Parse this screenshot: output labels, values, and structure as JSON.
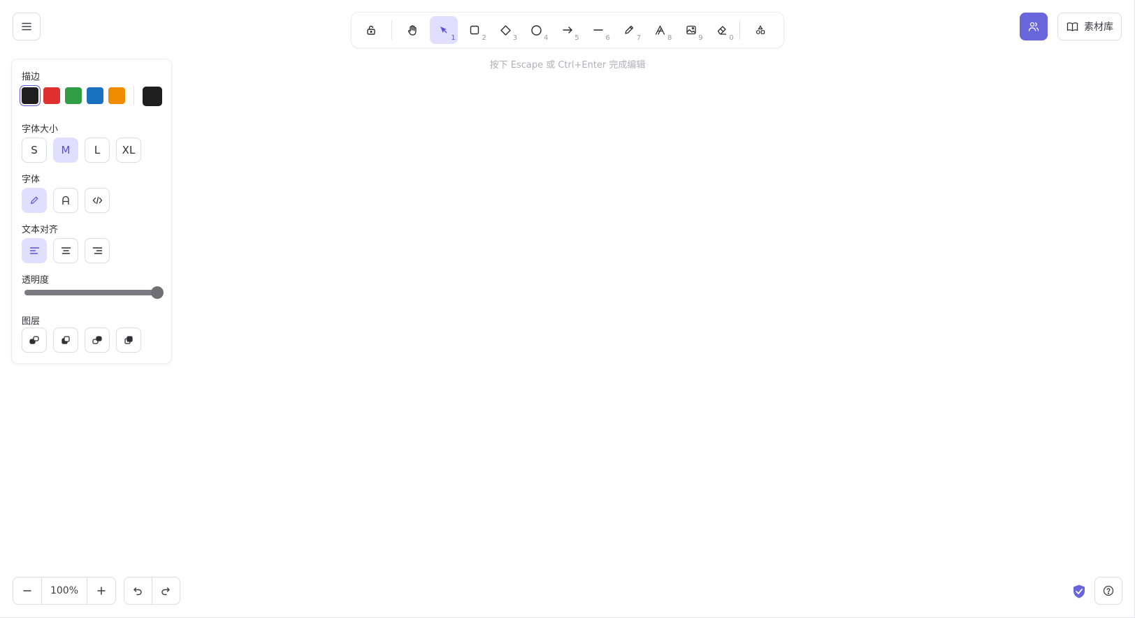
{
  "toolbar": {
    "tools": [
      {
        "name": "lock",
        "key": ""
      },
      {
        "name": "hand",
        "key": ""
      },
      {
        "name": "selection",
        "key": "1"
      },
      {
        "name": "rectangle",
        "key": "2"
      },
      {
        "name": "diamond",
        "key": "3"
      },
      {
        "name": "ellipse",
        "key": "4"
      },
      {
        "name": "arrow",
        "key": "5"
      },
      {
        "name": "line",
        "key": "6"
      },
      {
        "name": "draw",
        "key": "7"
      },
      {
        "name": "text",
        "key": "8"
      },
      {
        "name": "image",
        "key": "9"
      },
      {
        "name": "eraser",
        "key": "0"
      },
      {
        "name": "more-tools",
        "key": ""
      }
    ],
    "active_tool": "selection"
  },
  "hint": "按下 Escape 或 Ctrl+Enter 完成编辑",
  "header": {
    "library_label": "素材库"
  },
  "panel": {
    "stroke_title": "描边",
    "stroke_colors": [
      "#1e1e1e",
      "#e03131",
      "#2f9e44",
      "#1971c2",
      "#f08c00"
    ],
    "stroke_selected": "#1e1e1e",
    "font_size_title": "字体大小",
    "font_sizes": [
      "S",
      "M",
      "L",
      "XL"
    ],
    "font_size_selected": "M",
    "font_family_title": "字体",
    "font_family_selected": "hand-drawn",
    "text_align_title": "文本对齐",
    "text_align_selected": "left",
    "opacity_title": "透明度",
    "opacity_value": 100,
    "layers_title": "图层"
  },
  "footer": {
    "zoom_value": "100%"
  },
  "colors": {
    "accent": "#6965db",
    "active_bg": "#e0dfff"
  }
}
